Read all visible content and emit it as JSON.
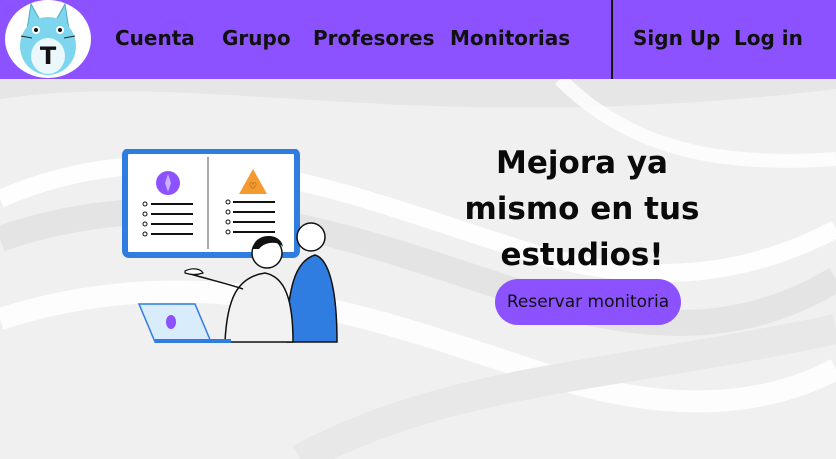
{
  "colors": {
    "nav_bg": "#8c52ff",
    "cta_bg": "#8c52ff",
    "page_bg": "#f1f1f1",
    "logo_face": "#7dd6ee"
  },
  "logo": {
    "letter": "T",
    "icon": "totoro-logo"
  },
  "nav": {
    "links": [
      "Cuenta",
      "Grupo",
      "Profesores",
      "Monitorias"
    ],
    "signup": "Sign Up",
    "login": "Log in"
  },
  "hero": {
    "headline": "Mejora ya mismo en tus estudios!",
    "cta": "Reservar monitoria",
    "illustration": "presentation-illustration"
  }
}
